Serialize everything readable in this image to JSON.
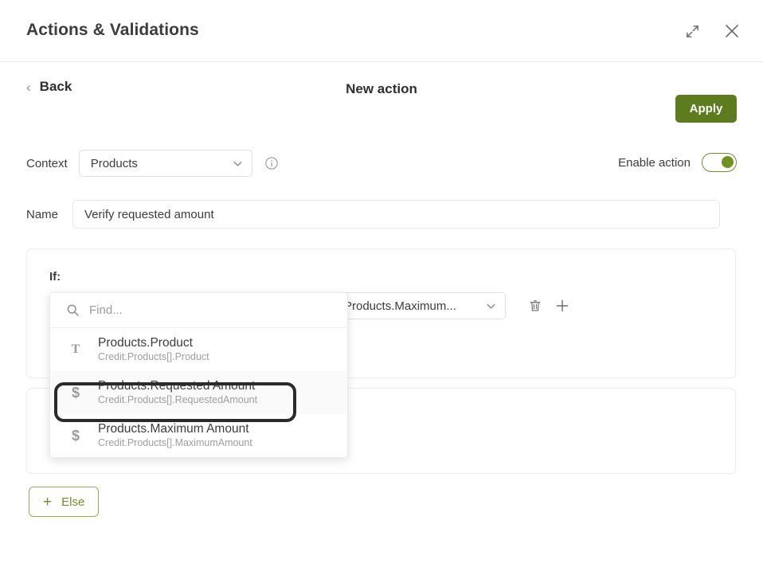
{
  "window": {
    "title": "Actions & Validations",
    "expand_icon": "expand-diagonal-icon",
    "close_icon": "close-icon"
  },
  "subheader": {
    "back_label": "Back",
    "back_chevron": "‹",
    "panel_title": "New action",
    "apply_label": "Apply"
  },
  "context": {
    "label": "Context",
    "value": "Products",
    "chevron": "chevron-down-icon",
    "info_icon": "info-circle-icon",
    "enable_label": "Enable action",
    "enable_state": "on"
  },
  "name": {
    "label": "Name",
    "value": "Verify requested amount",
    "placeholder": ""
  },
  "if_block": {
    "label": "If:",
    "operator_value": "",
    "right_value": "Products.Maximum...",
    "delete_icon": "trash-icon",
    "add_icon": "plus-icon"
  },
  "dropdown": {
    "search_placeholder": "Find...",
    "search_value": "",
    "search_icon": "search-icon",
    "items": [
      {
        "icon": "text-type-icon",
        "glyph": "T",
        "title": "Products.Product",
        "path": "Credit.Products[].Product",
        "selected": false
      },
      {
        "icon": "money-type-icon",
        "glyph": "$",
        "title": "Products.Requested Amount",
        "path": "Credit.Products[].RequestedAmount",
        "selected": true
      },
      {
        "icon": "money-type-icon",
        "glyph": "$",
        "title": "Products.Maximum Amount",
        "path": "Credit.Products[].MaximumAmount",
        "selected": false
      }
    ]
  },
  "else_button": {
    "plus": "+",
    "label": "Else"
  },
  "colors": {
    "apply_green": "#5d7c1e",
    "toggle_green": "#6f9222",
    "else_green": "#6f8f2a",
    "border_gray": "#ececec",
    "focus_black": "#2b2b2b"
  }
}
